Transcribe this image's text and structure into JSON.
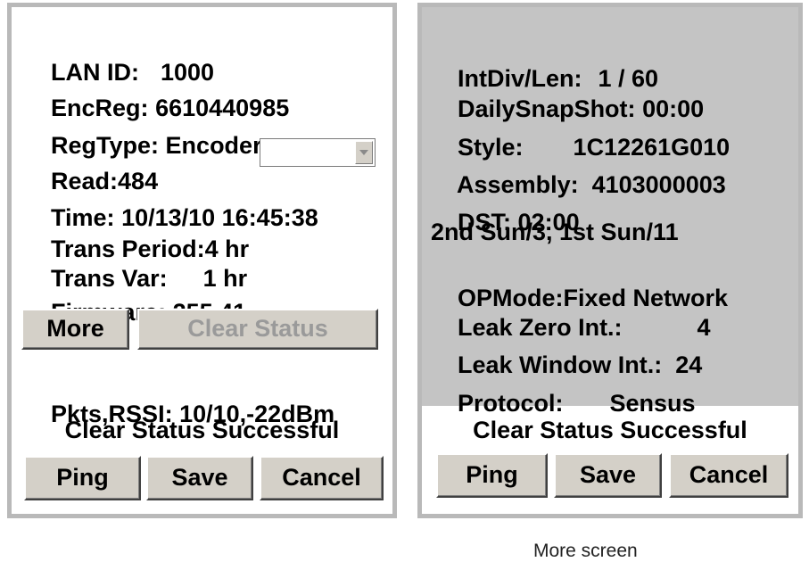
{
  "left_panel": {
    "lan_id": {
      "label": "LAN ID:",
      "value": "1000"
    },
    "enc_reg": {
      "label": "EncReg:",
      "value": "6610440985"
    },
    "reg_type": {
      "label": "RegType:",
      "value": "Encoder"
    },
    "read": {
      "label": "Read:",
      "value": "484",
      "dropdown_selected": ""
    },
    "time": {
      "label": "Time:",
      "value": "10/13/10 16:45:38"
    },
    "trans_period": {
      "label": "Trans Period:",
      "value": "4 hr"
    },
    "trans_var": {
      "label": "Trans Var:",
      "value": "1 hr"
    },
    "firmware": {
      "label": "Firmware:",
      "value": "255.41"
    },
    "more_button": "More",
    "clear_status_button": "Clear Status",
    "pkts_rssi": {
      "label": "Pkts,RSSI:",
      "value": "10/10,-22dBm"
    },
    "status_message": "Clear Status Successful",
    "buttons": {
      "ping": "Ping",
      "save": "Save",
      "cancel": "Cancel"
    }
  },
  "right_panel": {
    "int_div_len": {
      "label": "IntDiv/Len:",
      "value": "1 / 60"
    },
    "daily_snapshot": {
      "label": "DailySnapShot:",
      "value": "00:00"
    },
    "style": {
      "label": "Style:",
      "value": "1C12261G010"
    },
    "assembly": {
      "label": "Assembly:",
      "value": "4103000003"
    },
    "dst": {
      "label": "DST:",
      "value": "02:00"
    },
    "dst_rule": "2nd Sun/3, 1st Sun/11",
    "op_mode": {
      "label": "OPMode:",
      "value": "Fixed Network"
    },
    "leak_zero_int": {
      "label": "Leak Zero Int.:",
      "value": "4"
    },
    "leak_window_int": {
      "label": "Leak Window Int.:",
      "value": "24"
    },
    "protocol": {
      "label": "Protocol:",
      "value": "Sensus"
    },
    "status_message": "Clear Status Successful",
    "buttons": {
      "ping": "Ping",
      "save": "Save",
      "cancel": "Cancel"
    }
  },
  "caption": "More screen",
  "colors": {
    "panel_border": "#b9b9b9",
    "button_face": "#d4d0c8",
    "more_screen_background": "#c4c4c4",
    "disabled_text": "#9a9a9a"
  },
  "icons": {
    "dropdown_arrow": "chevron-down-icon"
  }
}
